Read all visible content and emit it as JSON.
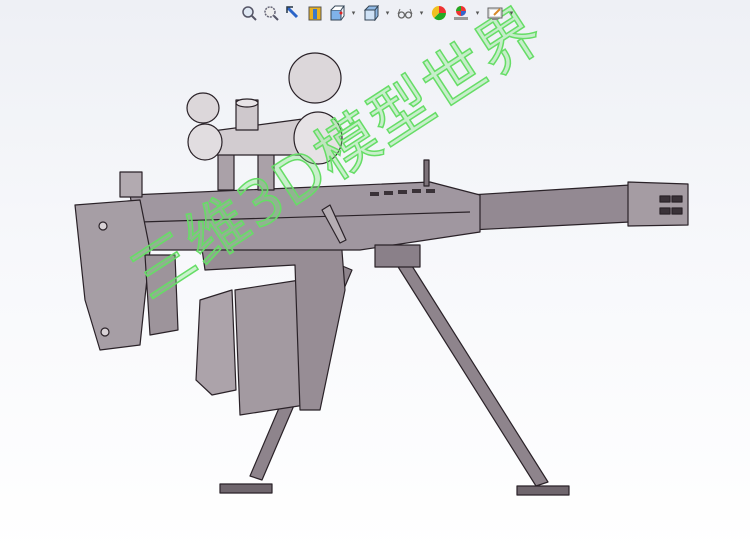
{
  "toolbar": {
    "items": [
      {
        "icon": "zoom-to-fit-icon"
      },
      {
        "icon": "zoom-to-area-icon"
      },
      {
        "icon": "previous-view-icon"
      },
      {
        "icon": "section-view-icon"
      },
      {
        "icon": "view-orientation-icon",
        "dropdown": true
      },
      {
        "icon": "display-style-icon",
        "dropdown": true
      },
      {
        "icon": "hide-show-items-icon",
        "dropdown": true
      },
      {
        "icon": "edit-appearance-icon"
      },
      {
        "icon": "apply-scene-icon",
        "dropdown": true
      },
      {
        "icon": "view-settings-icon",
        "dropdown": true
      }
    ],
    "dropdown_glyph": "▾"
  },
  "watermark": {
    "text": "三维3D模型世界"
  },
  "colors": {
    "model_fill": "#9a8f98",
    "model_edge": "#2a2228",
    "watermark": "#66dd66"
  }
}
